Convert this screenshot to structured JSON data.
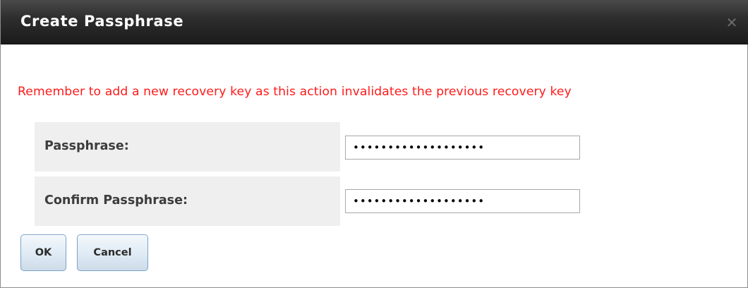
{
  "dialog": {
    "title": "Create Passphrase",
    "close_glyph": "✕"
  },
  "warning": "Remember to add a new recovery key as this action invalidates the previous recovery key",
  "fields": {
    "passphrase": {
      "label": "Passphrase:",
      "value": "•••••••••••••••••••"
    },
    "confirm": {
      "label": "Confirm Passphrase:",
      "value": "•••••••••••••••••••"
    }
  },
  "buttons": {
    "ok": "OK",
    "cancel": "Cancel"
  },
  "colors": {
    "warning": "#ff1a1a",
    "titlebar": "#2e2e2e",
    "row_bg": "#efefef",
    "button_border": "#7aa3c7"
  }
}
